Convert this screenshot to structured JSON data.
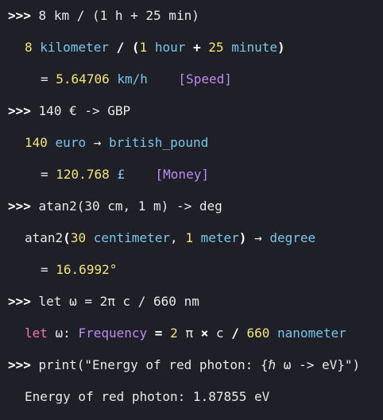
{
  "prompt": ">>>",
  "entries": [
    {
      "input": "8 km / (1 h + 25 min)",
      "parsed": {
        "n1": "8",
        "u1": "kilometer",
        "op1": "/",
        "lp": "(",
        "n2": "1",
        "u2": "hour",
        "op2": "+",
        "n3": "25",
        "u3": "minute",
        "rp": ")"
      },
      "result": {
        "eq": "=",
        "value": "5.64706",
        "unit": "km/h",
        "dimension": "[Speed]"
      }
    },
    {
      "input": "140 € -> GBP",
      "parsed": {
        "n1": "140",
        "u1": "euro",
        "arrow": "→",
        "u2": "british_pound"
      },
      "result": {
        "eq": "=",
        "value": "120.768",
        "unit": "£",
        "dimension": "[Money]"
      }
    },
    {
      "input": "atan2(30 cm, 1 m) -> deg",
      "parsed": {
        "fn": "atan2",
        "lp": "(",
        "n1": "30",
        "u1": "centimeter",
        "comma": ",",
        "n2": "1",
        "u2": "meter",
        "rp": ")",
        "arrow": "→",
        "u3": "degree"
      },
      "result": {
        "eq": "=",
        "value": "16.6992°"
      }
    },
    {
      "input": "let ω = 2π c / 660 nm",
      "parsed": {
        "kw": "let",
        "name": "ω:",
        "type": "Frequency",
        "eq": "=",
        "n1": "2",
        "pi": "π",
        "mul": "×",
        "c": "c",
        "div": "/",
        "n2": "660",
        "u1": "nanometer"
      }
    },
    {
      "input": "print(\"Energy of red photon: {ℏ ω -> eV}\")",
      "output": "Energy of red photon: 1.87855 eV"
    }
  ]
}
